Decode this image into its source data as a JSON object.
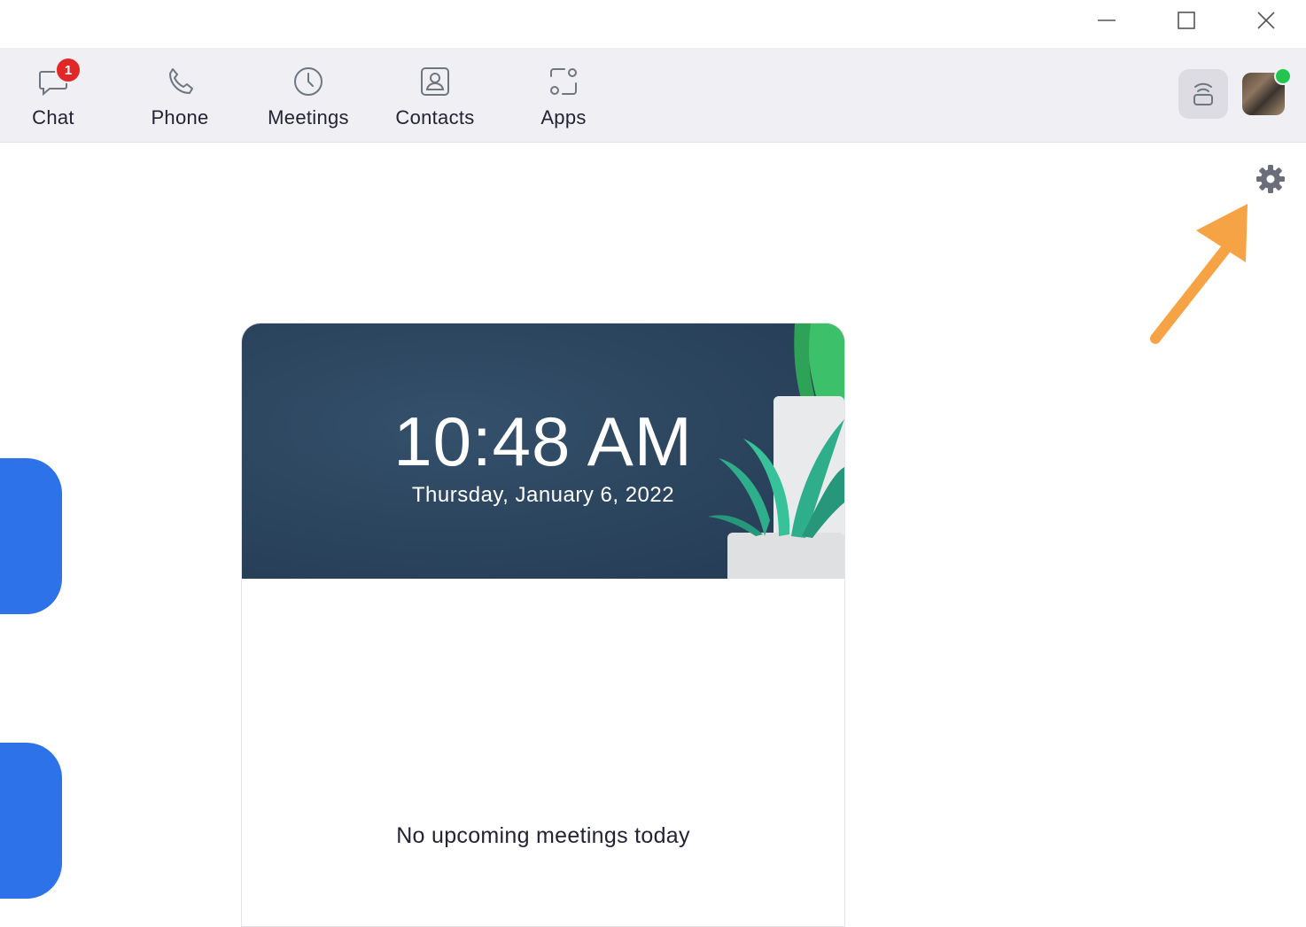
{
  "window": {
    "controls": [
      {
        "name": "minimize-icon"
      },
      {
        "name": "maximize-icon"
      },
      {
        "name": "close-icon"
      }
    ]
  },
  "nav": {
    "items": [
      {
        "label": "Chat",
        "icon": "chat-icon",
        "badge": "1"
      },
      {
        "label": "Phone",
        "icon": "phone-icon"
      },
      {
        "label": "Meetings",
        "icon": "clock-icon"
      },
      {
        "label": "Contacts",
        "icon": "contacts-icon"
      },
      {
        "label": "Apps",
        "icon": "apps-icon"
      }
    ],
    "cast_icon": "share-screen-icon",
    "avatar_status": "online",
    "status_color": "#23c551"
  },
  "settings": {
    "icon": "gear-icon"
  },
  "annotation": {
    "arrow_color": "#f5a345"
  },
  "home_buttons": {
    "color": "#2d72e8"
  },
  "clock_card": {
    "time": "10:48 AM",
    "date": "Thursday, January 6, 2022",
    "empty_message": "No upcoming meetings today"
  }
}
